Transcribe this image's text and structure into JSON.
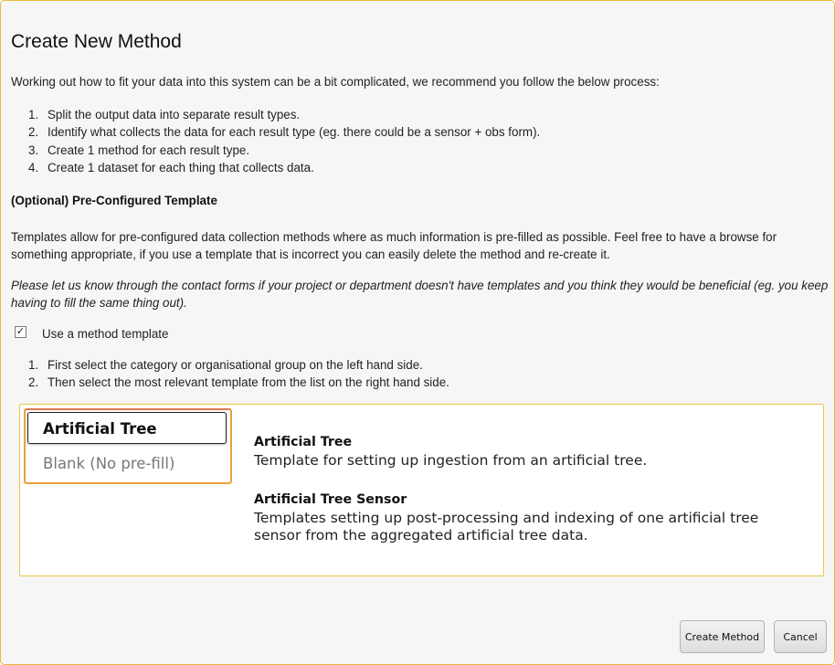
{
  "dialog": {
    "title": "Create New Method",
    "intro": "Working out how to fit your data into this system can be a bit complicated, we recommend you follow the below process:",
    "steps": [
      {
        "num": "1.",
        "text": "Split the output data into separate result types."
      },
      {
        "num": "2.",
        "text": "Identify what collects the data for each result type (eg. there could be a sensor + obs form)."
      },
      {
        "num": "3.",
        "text": "Create 1 method for each result type."
      },
      {
        "num": "4.",
        "text": "Create 1 dataset for each thing that collects data."
      }
    ],
    "section_heading": "(Optional) Pre-Configured Template",
    "templates_description": "Templates allow for pre-configured data collection methods where as much information is pre-filled as possible. Feel free to have a browse for something appropriate, if you use a template that is incorrect you can easily delete the method and re-create it.",
    "feedback_note": "Please let us know through the contact forms if your project or department doesn't have templates and you think they would be beneficial (eg. you keep having to fill the same thing out).",
    "use_template": {
      "label": "Use a method template",
      "checked": true,
      "check_glyph": "✓"
    },
    "instructions": [
      {
        "num": "1.",
        "text": "First select the category or organisational group on the left hand side."
      },
      {
        "num": "2.",
        "text": "Then select the most relevant template from the list on the right hand side."
      }
    ],
    "picker": {
      "categories": [
        {
          "label": "Artificial Tree",
          "selected": true
        },
        {
          "label": "Blank (No pre-fill)",
          "selected": false
        }
      ],
      "templates": [
        {
          "name": "Artificial Tree",
          "description": "Template for setting up ingestion from an artificial tree."
        },
        {
          "name": "Artificial Tree Sensor",
          "description": "Templates setting up post-processing and indexing of one artificial tree sensor from the aggregated artificial tree data."
        }
      ]
    },
    "buttons": {
      "create": "Create Method",
      "cancel": "Cancel"
    }
  },
  "colors": {
    "dialog_border": "#e9b93a",
    "dialog_background": "#f6f6f6",
    "picker_border": "#e9c64a",
    "category_border": "#e8a23a"
  }
}
